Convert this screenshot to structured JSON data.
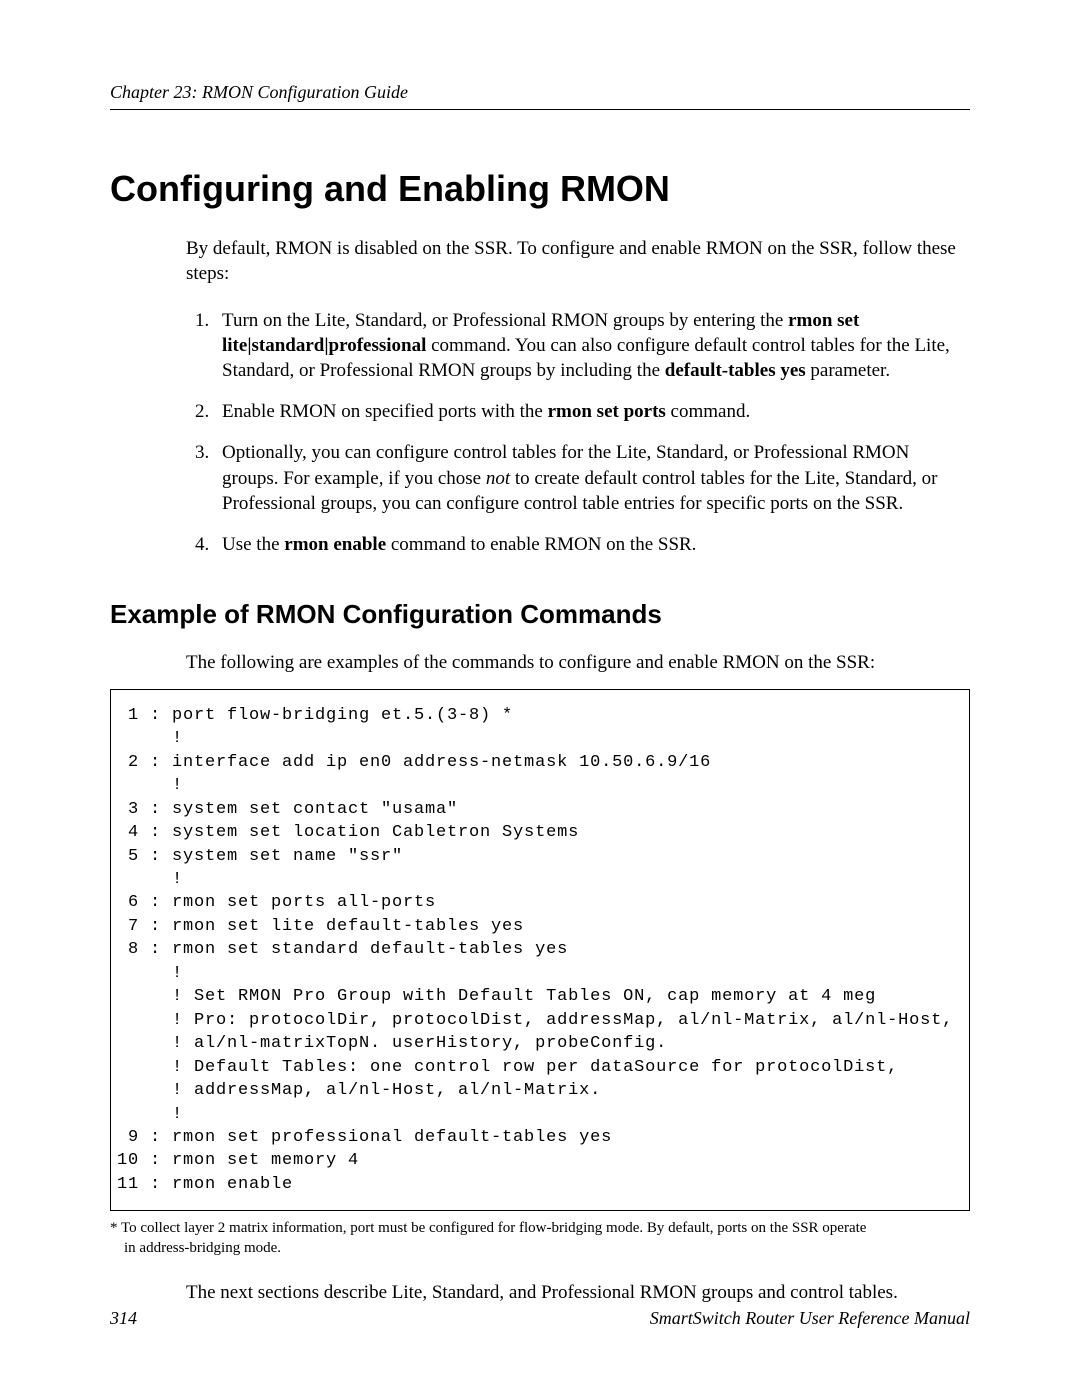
{
  "header": {
    "chapter": "Chapter 23: RMON Configuration Guide"
  },
  "title": "Configuring and Enabling RMON",
  "intro": "By default, RMON is disabled on the SSR. To configure and enable RMON on the SSR, follow these steps:",
  "steps": {
    "s1_a": "Turn on the Lite, Standard, or Professional RMON groups by entering the ",
    "s1_b": "rmon set lite|standard|professional",
    "s1_c": " command. You can also configure default control tables for the Lite, Standard, or Professional RMON groups by including the ",
    "s1_d": "default-tables yes",
    "s1_e": " parameter.",
    "s2_a": "Enable RMON on specified ports with the ",
    "s2_b": "rmon set ports",
    "s2_c": " command.",
    "s3_a": "Optionally, you can configure control tables for the Lite, Standard, or Professional RMON groups. For example, if you chose ",
    "s3_b": "not",
    "s3_c": " to create default control tables for the Lite, Standard, or Professional groups, you can configure control table entries for specific ports on the SSR.",
    "s4_a": "Use the ",
    "s4_b": "rmon enable",
    "s4_c": " command to enable RMON on the SSR."
  },
  "subhead": "Example of RMON Configuration Commands",
  "lead": "The following are examples of the commands to configure and enable RMON on the SSR:",
  "code": " 1 : port flow-bridging et.5.(3-8) *\n     !\n 2 : interface add ip en0 address-netmask 10.50.6.9/16\n     !\n 3 : system set contact \"usama\"\n 4 : system set location Cabletron Systems\n 5 : system set name \"ssr\"\n     !\n 6 : rmon set ports all-ports\n 7 : rmon set lite default-tables yes\n 8 : rmon set standard default-tables yes\n     !\n     ! Set RMON Pro Group with Default Tables ON, cap memory at 4 meg\n     ! Pro: protocolDir, protocolDist, addressMap, al/nl-Matrix, al/nl-Host,\n     ! al/nl-matrixTopN. userHistory, probeConfig.\n     ! Default Tables: one control row per dataSource for protocolDist,\n     ! addressMap, al/nl-Host, al/nl-Matrix.\n     !\n 9 : rmon set professional default-tables yes\n10 : rmon set memory 4\n11 : rmon enable",
  "footnote_a": "* To collect layer 2 matrix information, port must be configured for flow-bridging mode. By default, ports on the SSR operate",
  "footnote_b": "in address-bridging mode.",
  "closing": "The next sections describe Lite, Standard, and Professional RMON groups and control tables.",
  "footer": {
    "page": "314",
    "manual": "SmartSwitch Router User Reference Manual"
  }
}
